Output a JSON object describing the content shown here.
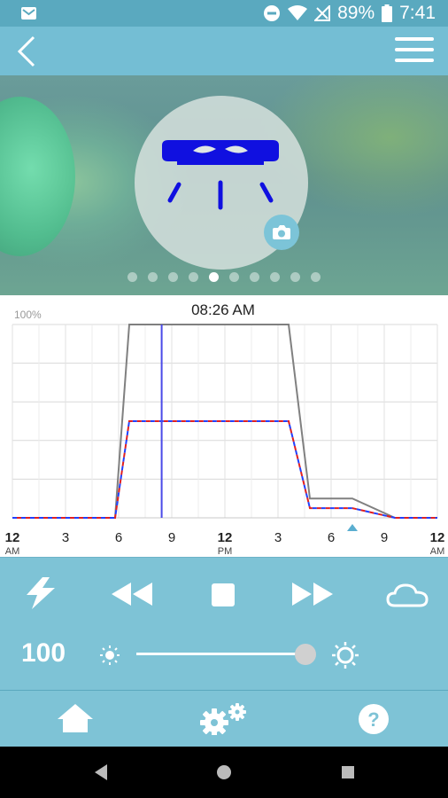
{
  "status_bar": {
    "battery_percent": "89%",
    "time": "7:41",
    "icons": [
      "mail-icon",
      "do-not-disturb-icon",
      "wifi-icon",
      "no-signal-icon",
      "battery-icon"
    ]
  },
  "header": {
    "back_icon": "chevron-left-icon",
    "menu_icon": "hamburger-menu-icon"
  },
  "hero": {
    "fixture_icon": "light-fixture-icon",
    "fixture_color": "#1010e0",
    "camera_icon": "camera-icon",
    "page_count": 10,
    "active_page": 5
  },
  "chart": {
    "current_time": "08:26 AM",
    "ymax_label": "100%",
    "x_ticks": [
      {
        "label": "12",
        "sub": "AM"
      },
      {
        "label": "3",
        "sub": ""
      },
      {
        "label": "6",
        "sub": ""
      },
      {
        "label": "9",
        "sub": ""
      },
      {
        "label": "12",
        "sub": "PM"
      },
      {
        "label": "3",
        "sub": ""
      },
      {
        "label": "6",
        "sub": ""
      },
      {
        "label": "9",
        "sub": ""
      },
      {
        "label": "12",
        "sub": "AM"
      }
    ]
  },
  "chart_data": {
    "type": "line",
    "xlabel": "",
    "ylabel": "",
    "xlim": [
      0,
      24
    ],
    "ylim": [
      0,
      100
    ],
    "current_time_hours": 8.43,
    "marker_time_hours": 19.2,
    "series": [
      {
        "color": "#808080",
        "style": "solid",
        "x": [
          0,
          5.8,
          6.6,
          15.6,
          16.8,
          19.2,
          21.6,
          24
        ],
        "y": [
          0,
          0,
          100,
          100,
          10,
          10,
          0,
          0
        ]
      },
      {
        "color": "#2040ff",
        "style": "dashed",
        "x": [
          0,
          5.8,
          6.6,
          15.6,
          16.8,
          19.2,
          21.6,
          24
        ],
        "y": [
          0,
          0,
          50,
          50,
          5,
          5,
          0,
          0
        ]
      },
      {
        "color": "#e02020",
        "style": "dashed",
        "x": [
          0,
          5.8,
          6.6,
          15.6,
          16.8,
          19.2,
          21.6,
          24
        ],
        "y": [
          0,
          0,
          50,
          50,
          5,
          5,
          0,
          0
        ]
      }
    ]
  },
  "controls": {
    "buttons": [
      "lightning-icon",
      "rewind-icon",
      "stop-icon",
      "fast-forward-icon",
      "cloud-icon"
    ],
    "brightness_value": "100",
    "brightness_level": 100
  },
  "bottom_nav": {
    "items": [
      "home-icon",
      "settings-gears-icon",
      "help-icon"
    ]
  },
  "system_nav": {
    "items": [
      "back-triangle-icon",
      "home-circle-icon",
      "recents-square-icon"
    ]
  }
}
